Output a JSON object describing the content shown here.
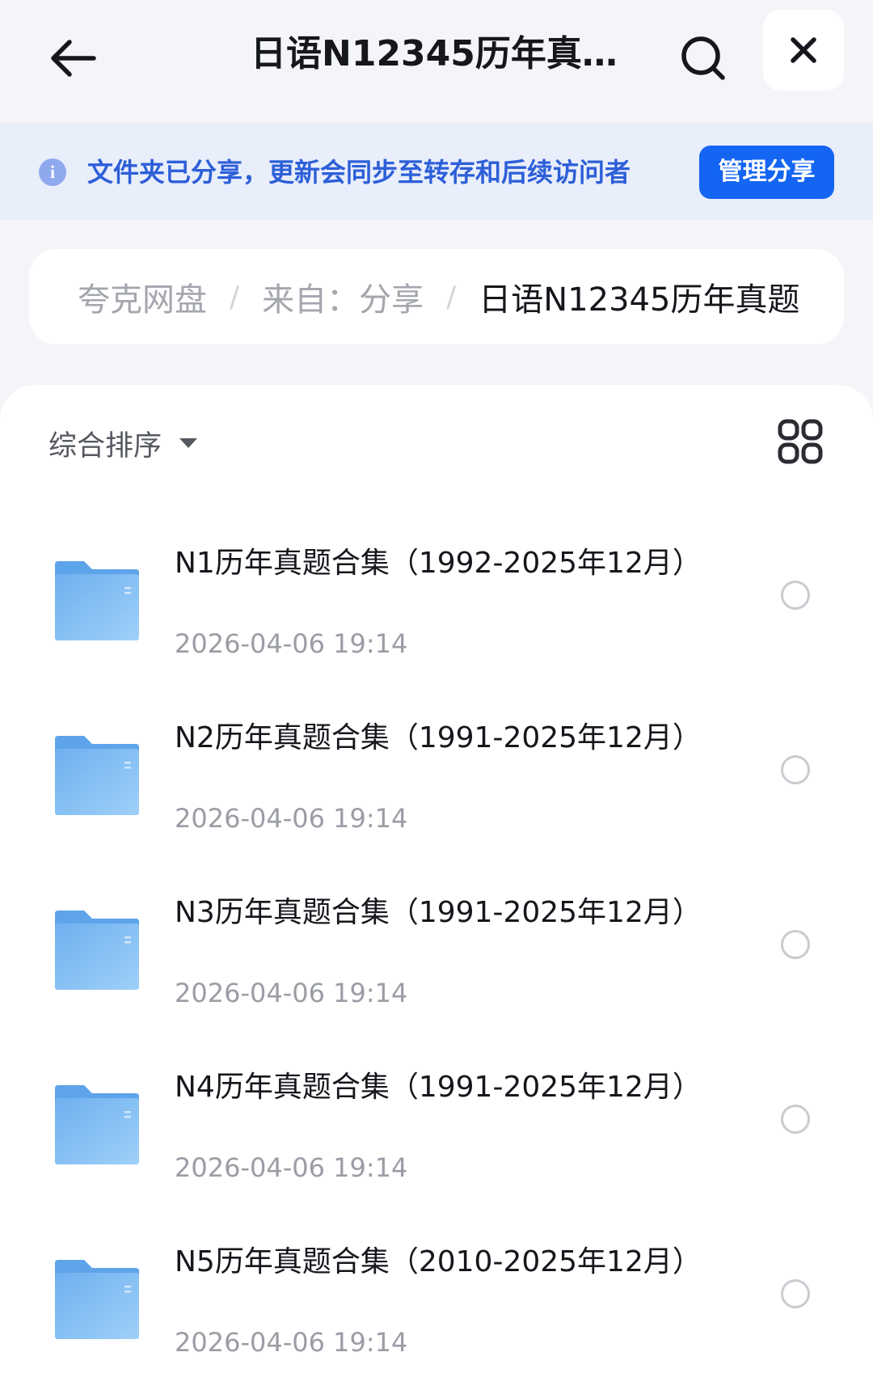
{
  "header": {
    "title": "日语N12345历年真…"
  },
  "banner": {
    "info_symbol": "i",
    "text": "文件夹已分享，更新会同步至转存和后续访问者",
    "manage_label": "管理分享"
  },
  "breadcrumb": {
    "root": "夸克网盘",
    "separator": "/",
    "source": "来自：分享",
    "current": "日语N12345历年真题"
  },
  "toolbar": {
    "sort_label": "综合排序"
  },
  "colors": {
    "accent": "#1465f2",
    "banner_text": "#2d5fd8",
    "folder": "#7fb8f2"
  },
  "files": [
    {
      "name": "N1历年真题合集（1992-2025年12月）",
      "date": "2026-04-06 19:14"
    },
    {
      "name": "N2历年真题合集（1991-2025年12月）",
      "date": "2026-04-06 19:14"
    },
    {
      "name": "N3历年真题合集（1991-2025年12月）",
      "date": "2026-04-06 19:14"
    },
    {
      "name": "N4历年真题合集（1991-2025年12月）",
      "date": "2026-04-06 19:14"
    },
    {
      "name": "N5历年真题合集（2010-2025年12月）",
      "date": "2026-04-06 19:14"
    }
  ]
}
